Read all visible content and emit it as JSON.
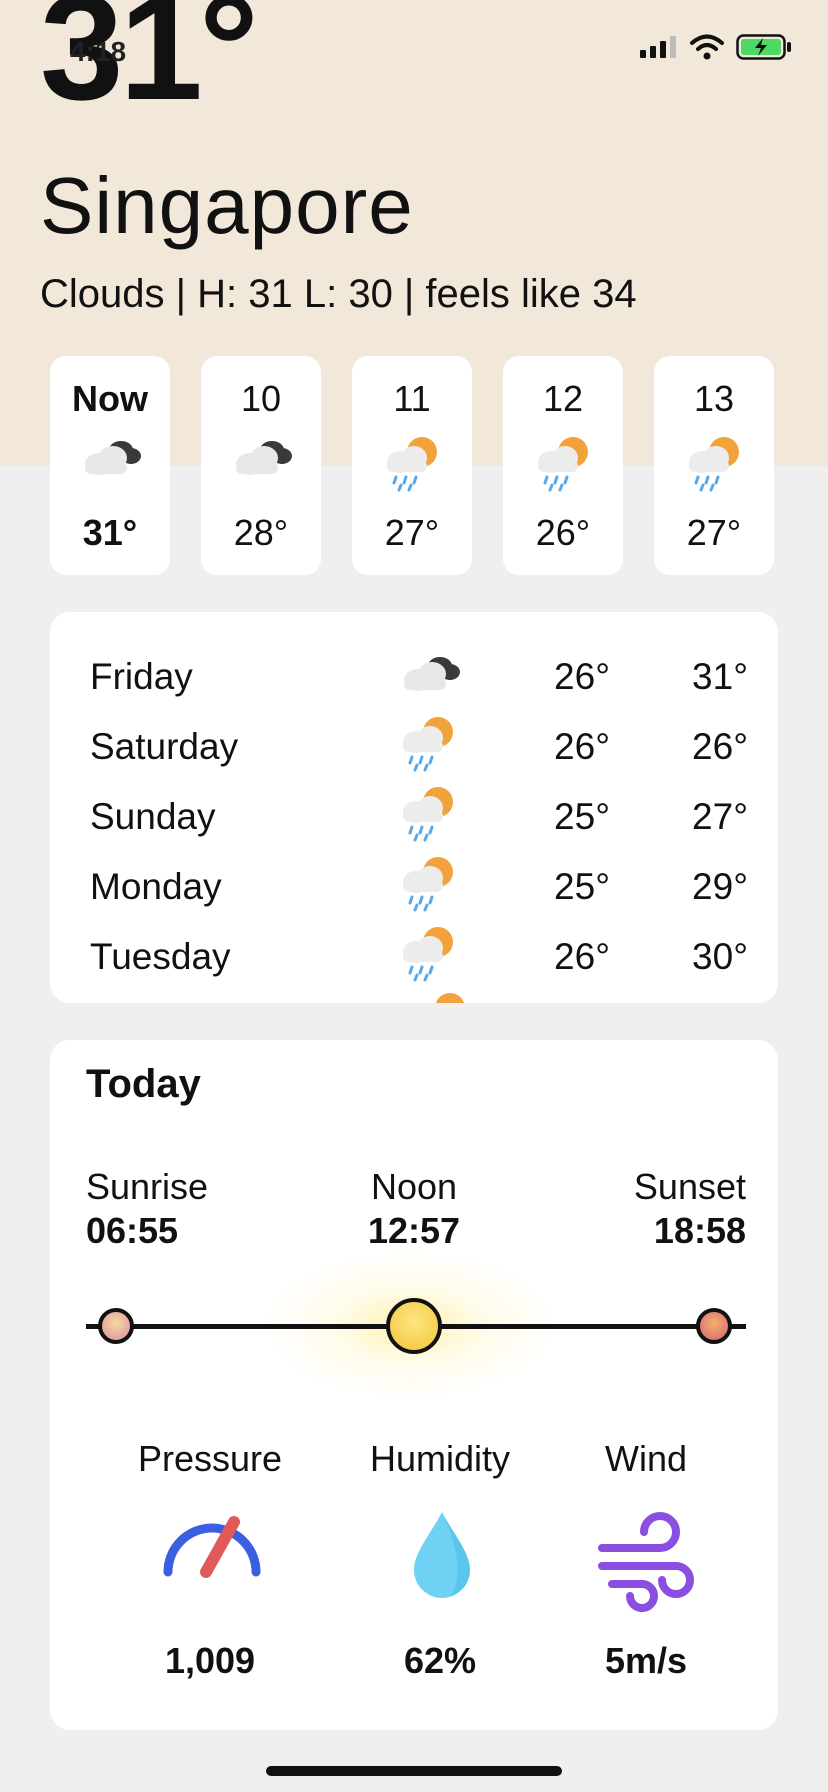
{
  "status_bar": {
    "time": "4:18"
  },
  "current": {
    "temperature": "31°",
    "city": "Singapore",
    "summary": "Clouds | H: 31 L: 30 | feels like 34"
  },
  "hourly": [
    {
      "label": "Now",
      "icon": "cloudy-night-icon",
      "temp": "31°"
    },
    {
      "label": "10",
      "icon": "cloudy-night-icon",
      "temp": "28°"
    },
    {
      "label": "11",
      "icon": "rain-sun-icon",
      "temp": "27°"
    },
    {
      "label": "12",
      "icon": "rain-sun-icon",
      "temp": "26°"
    },
    {
      "label": "13",
      "icon": "rain-sun-icon",
      "temp": "27°"
    }
  ],
  "daily": [
    {
      "day": "Friday",
      "icon": "cloudy-night-icon",
      "low": "26°",
      "high": "31°"
    },
    {
      "day": "Saturday",
      "icon": "rain-sun-icon",
      "low": "26°",
      "high": "26°"
    },
    {
      "day": "Sunday",
      "icon": "rain-sun-icon",
      "low": "25°",
      "high": "27°"
    },
    {
      "day": "Monday",
      "icon": "rain-sun-icon",
      "low": "25°",
      "high": "29°"
    },
    {
      "day": "Tuesday",
      "icon": "rain-sun-icon",
      "low": "26°",
      "high": "30°"
    }
  ],
  "today": {
    "title": "Today",
    "sunrise_label": "Sunrise",
    "sunrise_time": "06:55",
    "noon_label": "Noon",
    "noon_time": "12:57",
    "sunset_label": "Sunset",
    "sunset_time": "18:58",
    "pressure_label": "Pressure",
    "pressure_value": "1,009",
    "humidity_label": "Humidity",
    "humidity_value": "62%",
    "wind_label": "Wind",
    "wind_value": "5m/s"
  },
  "colors": {
    "top_bg": "#f1e8da",
    "page_bg": "#efefef",
    "sun_orange": "#f1a23a",
    "rain_blue": "#5aa8e6",
    "gauge_blue": "#3a5fe0",
    "gauge_red": "#e05a5a",
    "drop_blue": "#6fd2f5",
    "wind_purple": "#8a4fe0"
  }
}
